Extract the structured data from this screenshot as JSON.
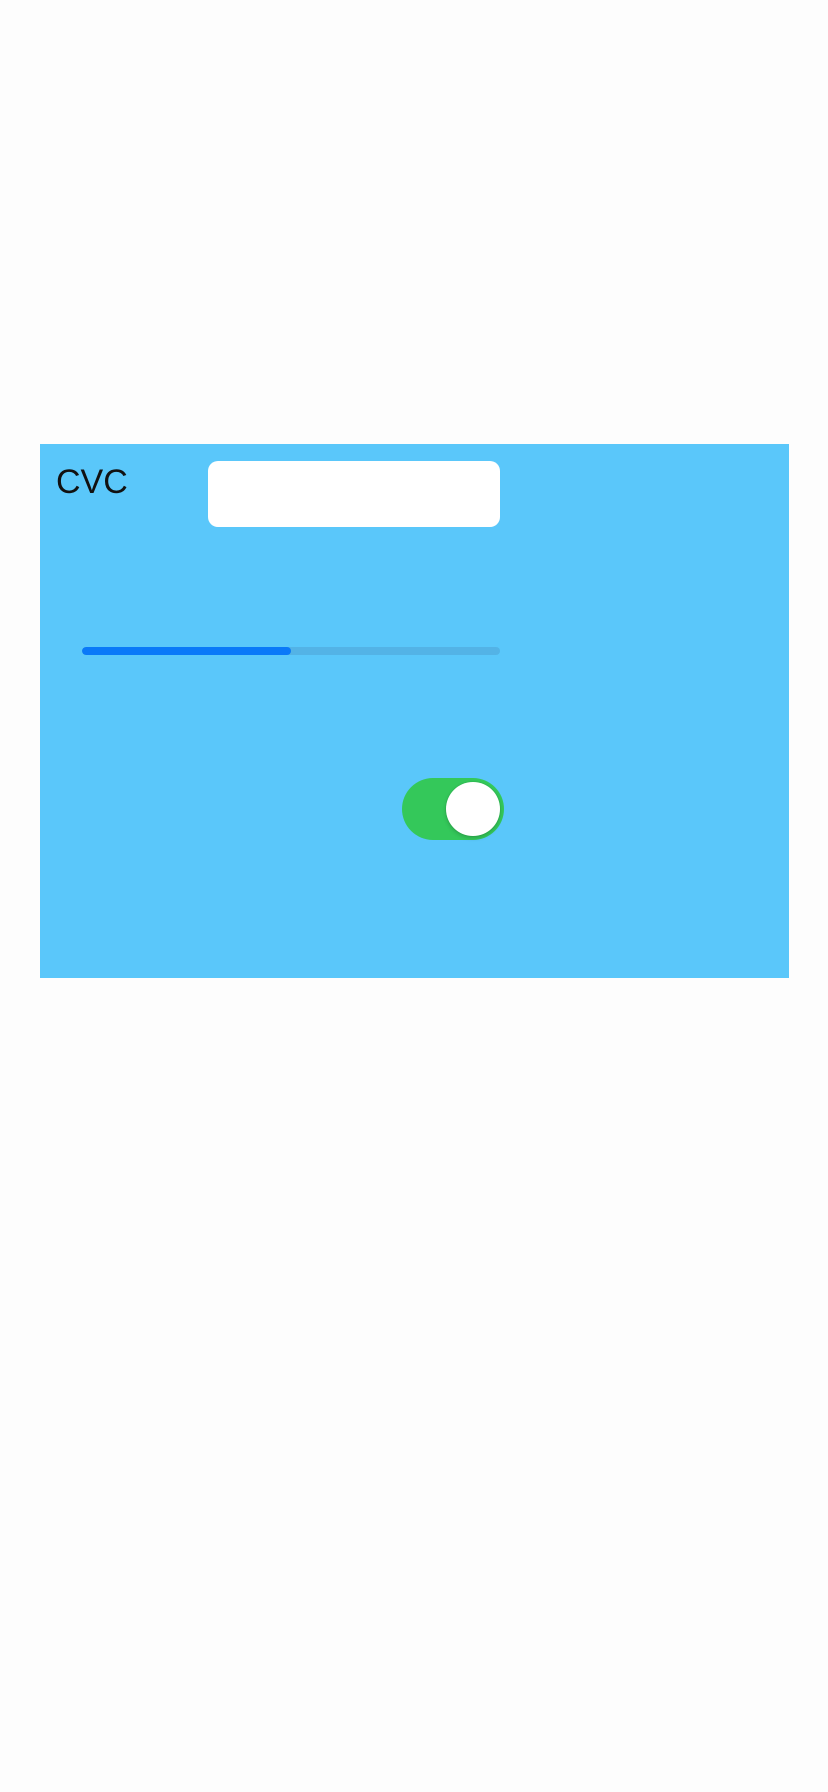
{
  "form": {
    "cvc_label": "CVC",
    "cvc_value": "",
    "cvc_placeholder": "",
    "progress": 0.5,
    "toggle_on": true
  },
  "colors": {
    "page_background": "#fdfdfd",
    "panel_background": "#5ac7fa",
    "progress_fill": "#0a79f8",
    "toggle_on": "#34c85a",
    "input_background": "#ffffff"
  }
}
